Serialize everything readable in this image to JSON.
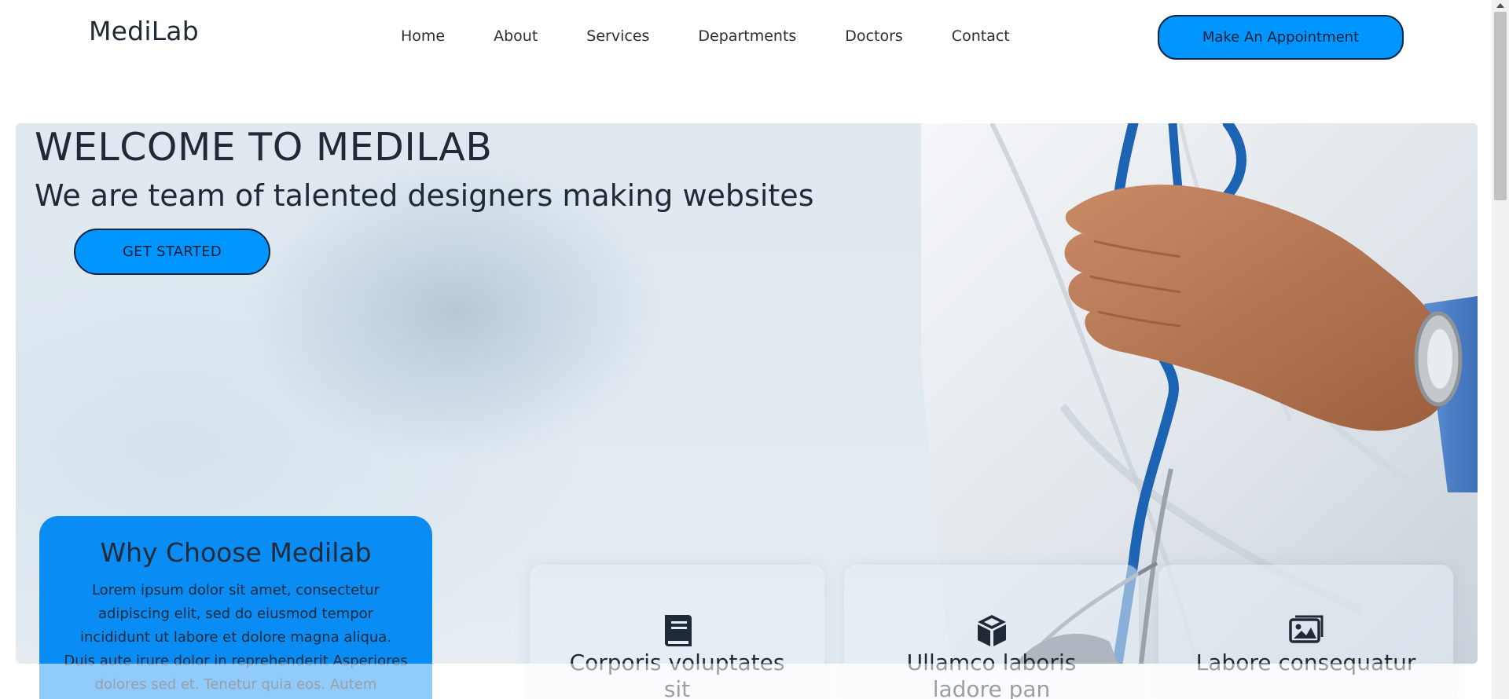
{
  "navbar": {
    "brand": "MediLab",
    "links": [
      "Home",
      "About",
      "Services",
      "Departments",
      "Doctors",
      "Contact"
    ],
    "appointment_label": "Make An Appointment",
    "accent_color": "#0095ff"
  },
  "hero": {
    "title": "WELCOME TO MEDILAB",
    "subtitle": "We are team of talented designers making websites",
    "cta_label": "GET STARTED"
  },
  "why": {
    "title": "Why Choose Medilab",
    "text": "Lorem ipsum dolor sit amet, consectetur adipiscing elit, sed do eiusmod tempor incididunt ut labore et dolore magna aliqua. Duis aute irure dolor in reprehenderit Asperiores dolores sed et. Tenetur quia eos. Autem tempore quibusdam vel"
  },
  "cards": [
    {
      "icon": "book-icon",
      "title": "Corporis voluptates sit"
    },
    {
      "icon": "cube-icon",
      "title": "Ullamco laboris ladore pan"
    },
    {
      "icon": "images-icon",
      "title": "Labore consequatur"
    }
  ]
}
